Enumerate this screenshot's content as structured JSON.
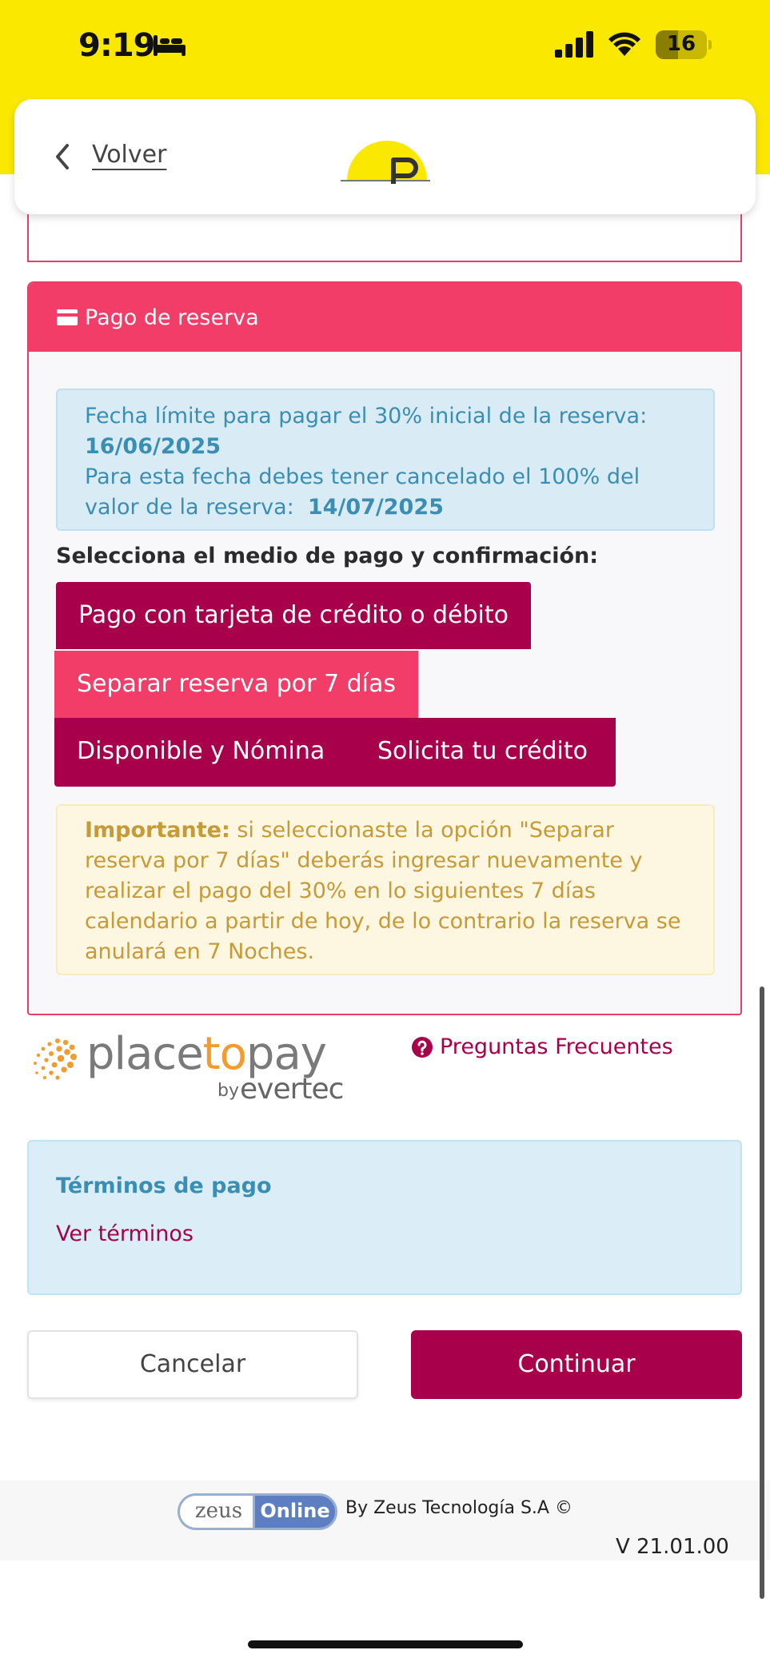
{
  "status_bar": {
    "time": "9:19",
    "battery": "16",
    "icons": [
      "bed-icon",
      "cellular-signal-icon",
      "wifi-icon",
      "battery-icon"
    ],
    "background_color": "#fbe800"
  },
  "header": {
    "back_label": "Volver",
    "logo_letter": "P"
  },
  "payment_card": {
    "title": "Pago de reserva",
    "info": {
      "line1_text": "Fecha límite para pagar el 30% inicial de la reserva:",
      "deadline_initial": "16/06/2025",
      "line2_text": "Para esta fecha debes tener cancelado el 100% del valor de la reserva:",
      "deadline_full": "14/07/2025"
    },
    "select_label": "Selecciona el medio de pago y confirmación:",
    "options": [
      "Pago con tarjeta de crédito o débito",
      "Separar reserva por 7 días",
      "Disponible y Nómina",
      "Solicita tu crédito"
    ],
    "warning": {
      "prefix": "Importante:",
      "text": "si seleccionaste la opción \"Separar reserva por 7 días\" deberás ingresar nuevamente y realizar el pago del 30% en lo siguientes 7 días calendario a partir de hoy, de lo contrario la reserva se anulará en  7 Noches."
    }
  },
  "provider": {
    "brand_part1": "place",
    "brand_part2": "to",
    "brand_part3": "pay",
    "by": "by",
    "sub_brand": "evertec",
    "faq_label": "Preguntas Frecuentes"
  },
  "terms": {
    "title": "Términos de pago",
    "link": "Ver términos"
  },
  "actions": {
    "cancel": "Cancelar",
    "continue": "Continuar"
  },
  "footer": {
    "badge_left": "zeus",
    "badge_right": "Online",
    "by_text": "By Zeus Tecnología S.A ©",
    "version": "V 21.01.00"
  },
  "colors": {
    "accent_magenta": "#a8004a",
    "accent_pink": "#f23d68",
    "info_blue": "#3a8eb3",
    "warning_text": "#c79a38"
  }
}
